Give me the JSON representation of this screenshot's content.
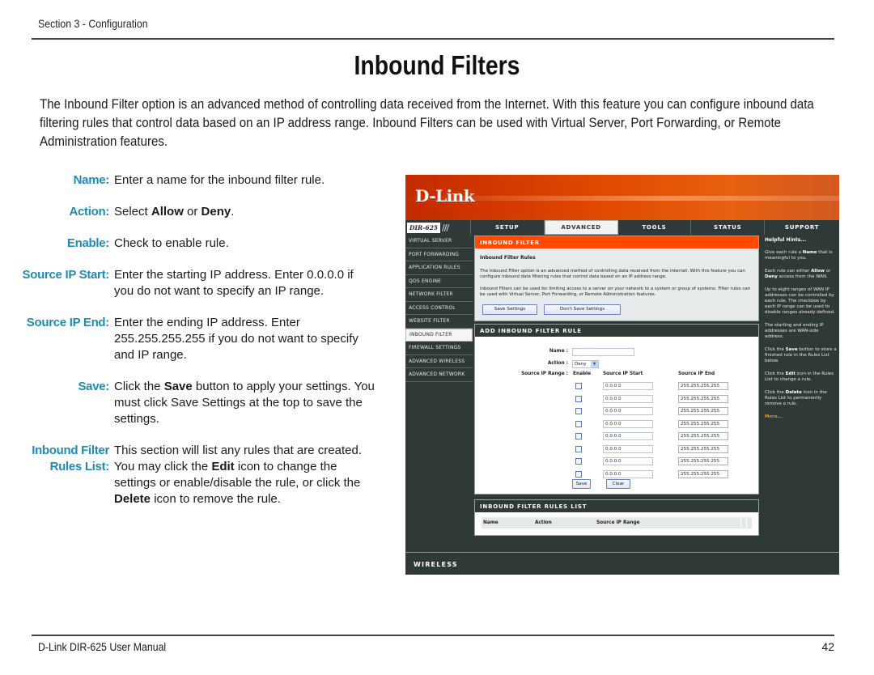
{
  "page": {
    "section_header": "Section 3 - Configuration",
    "title": "Inbound Filters",
    "intro": "The Inbound Filter option is an advanced method of controlling data received from the Internet. With this feature you can configure inbound data filtering rules that control data based on an IP address range.  Inbound Filters can be used with Virtual Server, Port Forwarding, or Remote Administration features.",
    "footer_left": "D-Link DIR-625 User Manual",
    "page_number": "42"
  },
  "definitions": [
    {
      "term": "Name:",
      "desc": "Enter a name for the inbound filter rule."
    },
    {
      "term": "Action:",
      "desc_pre": "Select ",
      "desc_b1": "Allow",
      "desc_mid": " or ",
      "desc_b2": "Deny",
      "desc_post": "."
    },
    {
      "term": "Enable:",
      "desc": "Check to enable rule."
    },
    {
      "term": "Source IP Start:",
      "desc": "Enter the starting IP address. Enter 0.0.0.0 if you do not want to specify an IP range."
    },
    {
      "term": "Source IP End:",
      "desc": "Enter the ending IP address. Enter 255.255.255.255 if you do not want to specify and IP range."
    },
    {
      "term": "Save:",
      "desc_pre": "Click the ",
      "desc_b1": "Save",
      "desc_post": " button to apply your settings. You must click Save Settings at the top to save the settings."
    },
    {
      "term_line1": "Inbound Filter",
      "term_line2": "Rules List:",
      "desc_pre": "This section will list any rules that are created. You may click the ",
      "desc_b1": "Edit",
      "desc_mid": " icon to change the settings or enable/disable the rule, or click the ",
      "desc_b2": "Delete",
      "desc_post": " icon to remove the rule."
    }
  ],
  "router": {
    "logo": "D-Link",
    "model": "DIR-625",
    "tabs": [
      "SETUP",
      "ADVANCED",
      "TOOLS",
      "STATUS",
      "SUPPORT"
    ],
    "active_tab": "ADVANCED",
    "sidebar": [
      "VIRTUAL SERVER",
      "PORT FORWARDING",
      "APPLICATION RULES",
      "QOS ENGINE",
      "NETWORK FILTER",
      "ACCESS CONTROL",
      "WEBSITE FILTER",
      "INBOUND FILTER",
      "FIREWALL SETTINGS",
      "ADVANCED WIRELESS",
      "ADVANCED NETWORK"
    ],
    "active_sidebar": "INBOUND FILTER",
    "inbound_filter": {
      "heading": "INBOUND FILTER",
      "subheading": "Inbound Filter Rules",
      "para1": "The Inbound Filter option is an advanced method of controlling data received from the Internet. With this feature you can configure inbound data filtering rules that control data based on an IP address range.",
      "para2": "Inbound Filters can be used for limiting access to a server on your network to a system or group of systems. Filter rules can be used with Virtual Server, Port Forwarding, or Remote Administration features.",
      "save_settings": "Save Settings",
      "dont_save_settings": "Don't Save Settings"
    },
    "add_rule": {
      "heading": "ADD INBOUND FILTER RULE",
      "name_label": "Name :",
      "name_value": "",
      "action_label": "Action :",
      "action_value": "Deny",
      "range_label": "Source IP Range :",
      "col_enable": "Enable",
      "col_start": "Source IP Start",
      "col_end": "Source IP End",
      "rows": [
        {
          "enabled": false,
          "start": "0.0.0.0",
          "end": "255.255.255.255"
        },
        {
          "enabled": false,
          "start": "0.0.0.0",
          "end": "255.255.255.255"
        },
        {
          "enabled": false,
          "start": "0.0.0.0",
          "end": "255.255.255.255"
        },
        {
          "enabled": false,
          "start": "0.0.0.0",
          "end": "255.255.255.255"
        },
        {
          "enabled": false,
          "start": "0.0.0.0",
          "end": "255.255.255.255"
        },
        {
          "enabled": false,
          "start": "0.0.0.0",
          "end": "255.255.255.255"
        },
        {
          "enabled": false,
          "start": "0.0.0.0",
          "end": "255.255.255.255"
        },
        {
          "enabled": false,
          "start": "0.0.0.0",
          "end": "255.255.255.255"
        }
      ],
      "save": "Save",
      "clear": "Clear"
    },
    "rules_list": {
      "heading": "INBOUND FILTER RULES LIST",
      "columns": [
        "Name",
        "Action",
        "Source IP Range"
      ]
    },
    "hints": {
      "title": "Helpful Hints...",
      "h1_pre": "Give each rule a ",
      "h1_b": "Name",
      "h1_post": " that is meaningful to you.",
      "h2_pre": "Each rule can either ",
      "h2_b1": "Allow",
      "h2_mid": " or ",
      "h2_b2": "Deny",
      "h2_post": " access from the WAN.",
      "h3": "Up to eight ranges of WAN IP addresses can be controlled by each rule. The checkbox by each IP range can be used to disable ranges already defined.",
      "h4": "The starting and ending IP addresses are WAN-side address.",
      "h5_pre": "Click the ",
      "h5_b": "Save",
      "h5_post": " button to store a finished rule in the Rules List below.",
      "h6_pre": "Click the ",
      "h6_b": "Edit",
      "h6_post": " icon in the Rules List to change a rule.",
      "h7_pre": "Click the ",
      "h7_b": "Delete",
      "h7_post": " icon in the Rules List to permanently remove a rule.",
      "more": "More..."
    },
    "footer_brand": "WIRELESS"
  },
  "colors": {
    "term_blue": "#1f8bb5",
    "router_dark": "#2f3a38",
    "router_orange": "#ff4a00",
    "hint_more": "#ff8a00"
  }
}
